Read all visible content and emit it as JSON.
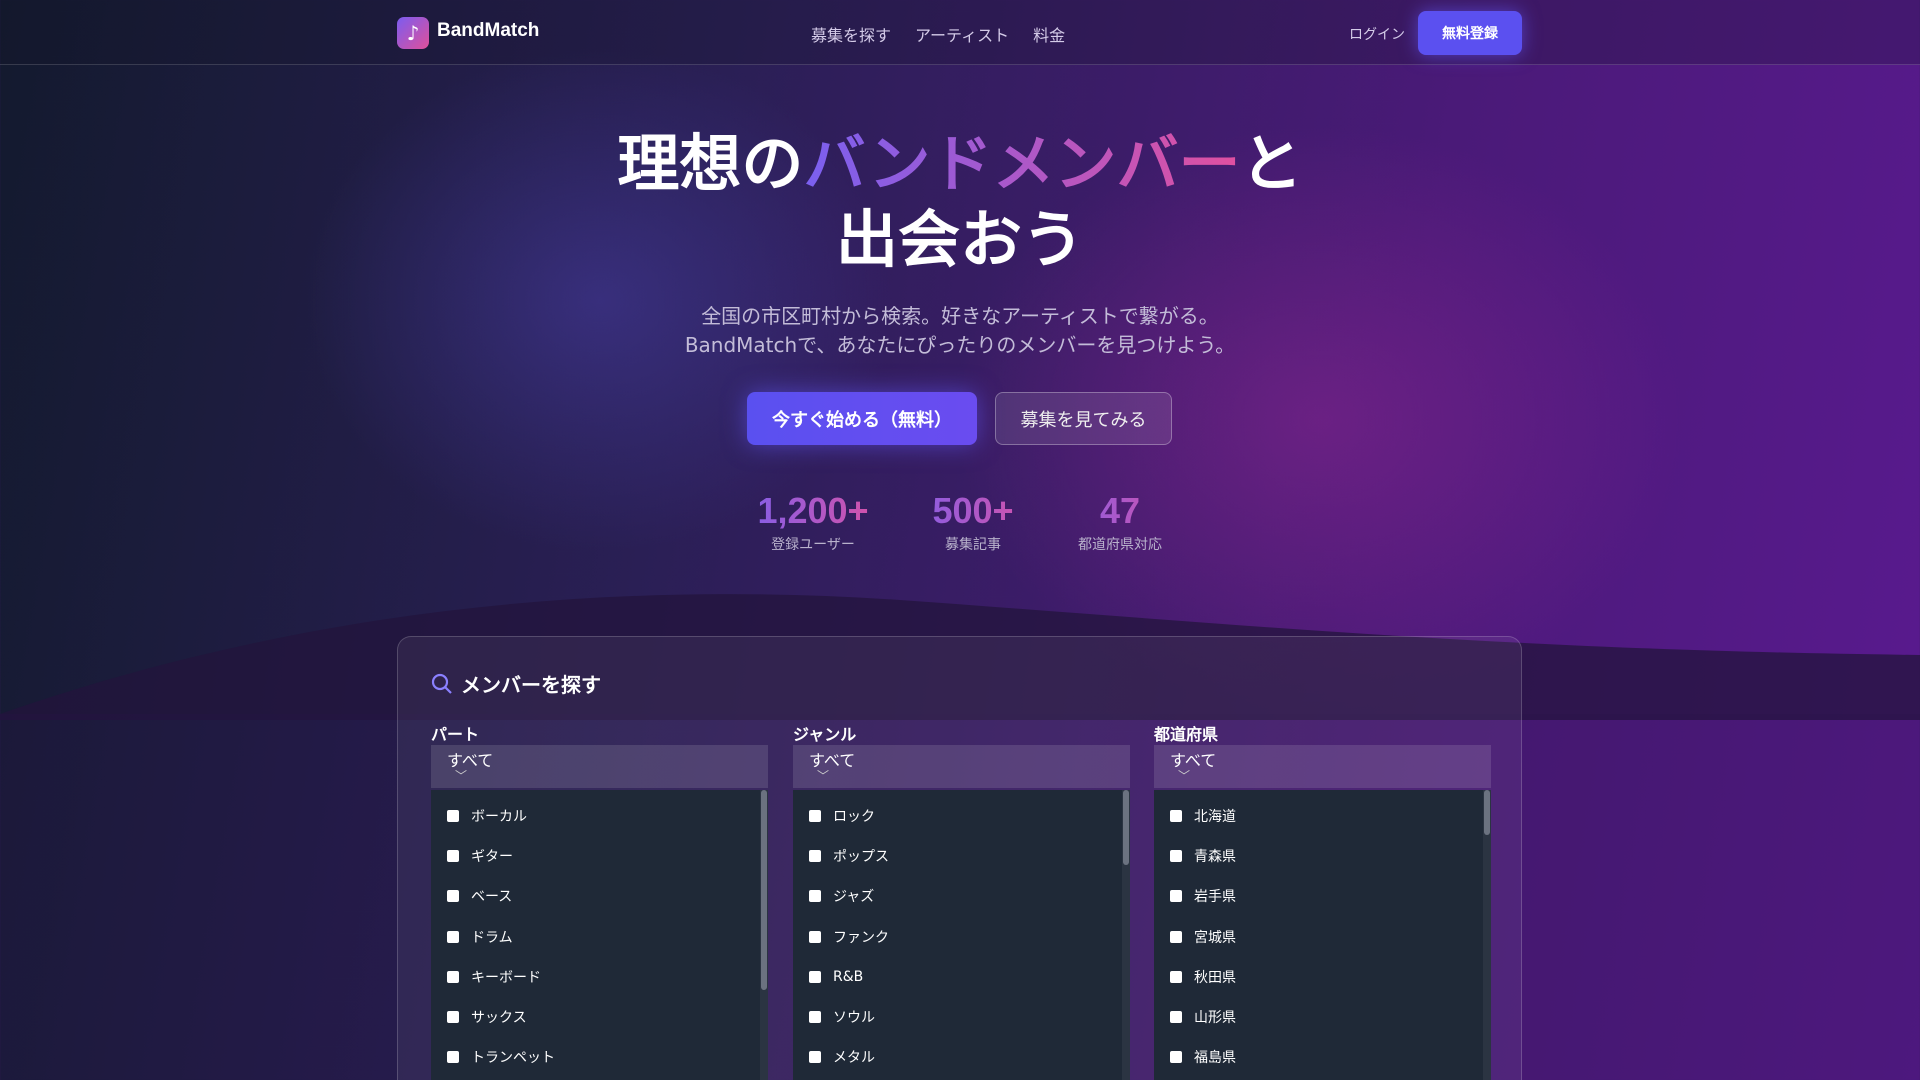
{
  "nav": {
    "brand": "BandMatch",
    "links": [
      "募集を探す",
      "アーティスト",
      "料金"
    ],
    "login": "ログイン",
    "signup": "無料登録"
  },
  "hero": {
    "title_a": "理想の",
    "title_highlight": "バンドメンバー",
    "title_b": "と",
    "title_line2": "出会おう",
    "subtitle_1": "全国の市区町村から検索。好きなアーティストで繋がる。",
    "subtitle_2": "BandMatchで、あなたにぴったりのメンバーを見つけよう。",
    "cta_primary": "今すぐ始める（無料）",
    "cta_secondary": "募集を見てみる"
  },
  "stats": [
    {
      "value": "1,200+",
      "label": "登録ユーザー"
    },
    {
      "value": "500+",
      "label": "募集記事"
    },
    {
      "value": "47",
      "label": "都道府県対応"
    }
  ],
  "search": {
    "title": "メンバーを探す",
    "filters": [
      {
        "label": "パート",
        "selected": "すべて",
        "options": [
          "ボーカル",
          "ギター",
          "ベース",
          "ドラム",
          "キーボード",
          "サックス",
          "トランペット"
        ]
      },
      {
        "label": "ジャンル",
        "selected": "すべて",
        "options": [
          "ロック",
          "ポップス",
          "ジャズ",
          "ファンク",
          "R&B",
          "ソウル",
          "メタル"
        ]
      },
      {
        "label": "都道府県",
        "selected": "すべて",
        "options": [
          "北海道",
          "青森県",
          "岩手県",
          "宮城県",
          "秋田県",
          "山形県",
          "福島県"
        ]
      }
    ]
  }
}
